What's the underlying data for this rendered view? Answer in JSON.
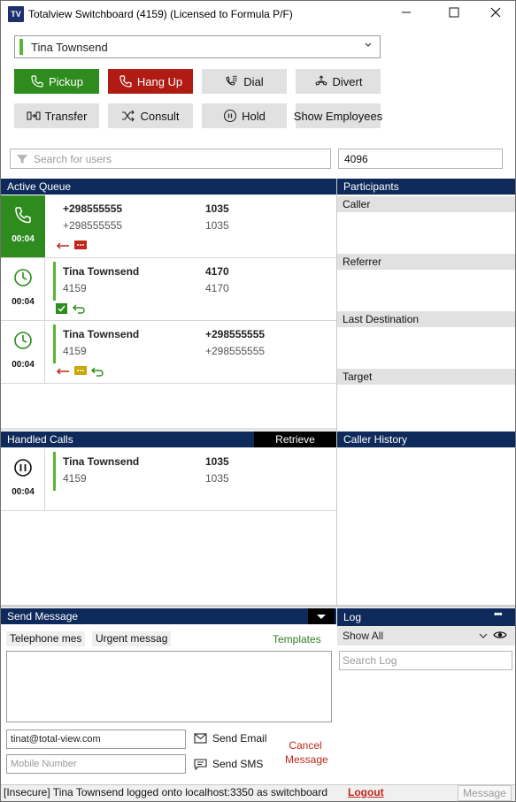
{
  "window": {
    "logo": "TV",
    "title": "Totalview Switchboard (4159) (Licensed to Formula P/F)"
  },
  "user_select": {
    "value": "Tina Townsend"
  },
  "toolbar": {
    "pickup": "Pickup",
    "hangup": "Hang Up",
    "dial": "Dial",
    "divert": "Divert",
    "transfer": "Transfer",
    "consult": "Consult",
    "hold": "Hold",
    "show_employees": "Show Employees"
  },
  "search": {
    "placeholder": "Search for users",
    "extension_value": "4096"
  },
  "active_queue": {
    "title": "Active Queue",
    "calls": [
      {
        "status": "active",
        "timer": "00:04",
        "name": "+298555555",
        "sub": "+298555555",
        "number": "1035",
        "number_sub": "1035",
        "badges": [
          "incoming-arrow",
          "message-red"
        ]
      },
      {
        "status": "waiting",
        "timer": "00:04",
        "name": "Tina Townsend",
        "sub": "4159",
        "number": "4170",
        "number_sub": "4170",
        "badges": [
          "check-green",
          "return-green"
        ]
      },
      {
        "status": "waiting",
        "timer": "00:04",
        "name": "Tina Townsend",
        "sub": "4159",
        "number": "+298555555",
        "number_sub": "+298555555",
        "badges": [
          "incoming-arrow",
          "message-yellow",
          "return-green"
        ]
      }
    ]
  },
  "participants": {
    "title": "Participants",
    "caller": "Caller",
    "referrer": "Referrer",
    "last_destination": "Last Destination",
    "target": "Target"
  },
  "handled_calls": {
    "title": "Handled Calls",
    "retrieve": "Retrieve",
    "calls": [
      {
        "status": "hold",
        "timer": "00:04",
        "name": "Tina Townsend",
        "sub": "4159",
        "number": "1035",
        "number_sub": "1035"
      }
    ]
  },
  "caller_history": {
    "title": "Caller History"
  },
  "send_message": {
    "title": "Send Message",
    "tab1": "Telephone mes",
    "tab2": "Urgent messag",
    "templates": "Templates",
    "email_value": "tinat@total-view.com",
    "mobile_placeholder": "Mobile Number",
    "send_email": "Send Email",
    "send_sms": "Send SMS",
    "cancel": "Cancel Message"
  },
  "log": {
    "title": "Log",
    "more": "•••",
    "filter_value": "Show All",
    "search_placeholder": "Search Log"
  },
  "status": {
    "text": "[Insecure] Tina Townsend logged onto localhost:3350 as switchboard",
    "logout": "Logout",
    "message_button": "Message"
  },
  "colors": {
    "header_navy": "#0e2a5a",
    "green": "#2e8b1e",
    "red": "#b01c14",
    "accent_green": "#5cb531"
  }
}
